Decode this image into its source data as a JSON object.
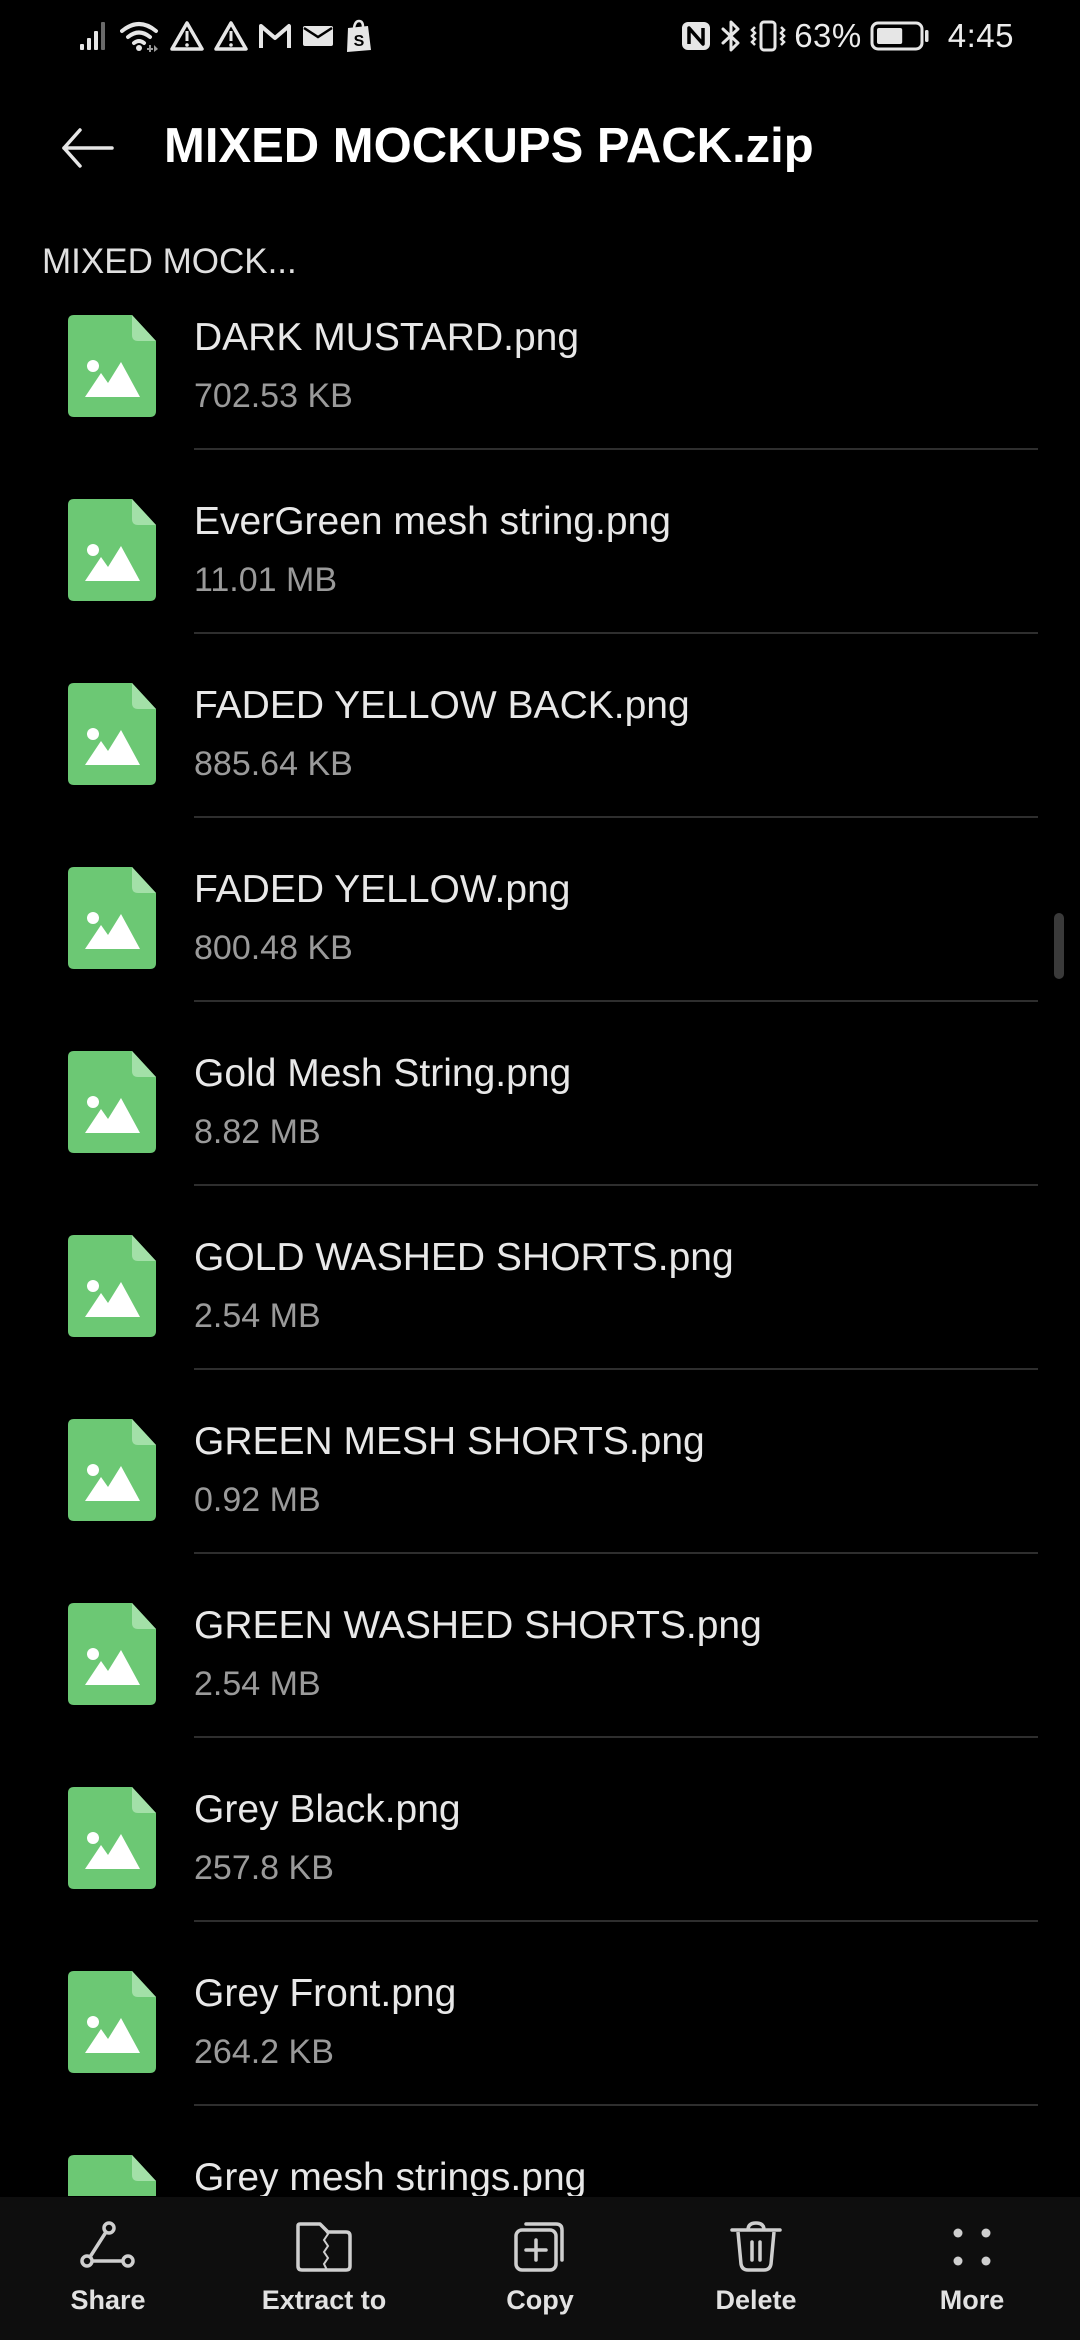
{
  "status_bar": {
    "left_icons": [
      "signal-icon",
      "wifi-icon",
      "warning-icon",
      "warning-icon",
      "gmail-icon",
      "mail-icon",
      "shopify-icon"
    ],
    "right_icons": [
      "nfc-icon",
      "bluetooth-icon",
      "vibrate-icon",
      "battery-icon"
    ],
    "battery_percent": "63%",
    "battery_level": 0.63,
    "time": "4:45"
  },
  "header": {
    "title": "MIXED MOCKUPS PACK.zip",
    "back_icon": "arrow-left-icon"
  },
  "breadcrumb": {
    "label": "MIXED MOCK..."
  },
  "files": [
    {
      "name": "DARK MUSTARD.png",
      "size": "702.53 KB",
      "icon": "image-file-icon"
    },
    {
      "name": "EverGreen mesh string.png",
      "size": "11.01 MB",
      "icon": "image-file-icon"
    },
    {
      "name": "FADED YELLOW BACK.png",
      "size": "885.64 KB",
      "icon": "image-file-icon"
    },
    {
      "name": "FADED YELLOW.png",
      "size": "800.48 KB",
      "icon": "image-file-icon"
    },
    {
      "name": "Gold Mesh String.png",
      "size": "8.82 MB",
      "icon": "image-file-icon"
    },
    {
      "name": "GOLD WASHED SHORTS.png",
      "size": "2.54 MB",
      "icon": "image-file-icon"
    },
    {
      "name": "GREEN MESH SHORTS.png",
      "size": "0.92 MB",
      "icon": "image-file-icon"
    },
    {
      "name": "GREEN WASHED SHORTS.png",
      "size": "2.54 MB",
      "icon": "image-file-icon"
    },
    {
      "name": "Grey Black.png",
      "size": "257.8 KB",
      "icon": "image-file-icon"
    },
    {
      "name": "Grey Front.png",
      "size": "264.2 KB",
      "icon": "image-file-icon"
    },
    {
      "name": "Grey mesh strings.png",
      "size": "",
      "icon": "image-file-icon"
    }
  ],
  "toolbar": {
    "share_label": "Share",
    "extract_label": "Extract to",
    "copy_label": "Copy",
    "delete_label": "Delete",
    "more_label": "More"
  },
  "colors": {
    "background": "#000000",
    "file_icon_green": "#6cc874",
    "file_icon_fold": "#a3e0a8",
    "toolbar_bg": "#0e0e0e",
    "divider": "#2e2e2e"
  }
}
